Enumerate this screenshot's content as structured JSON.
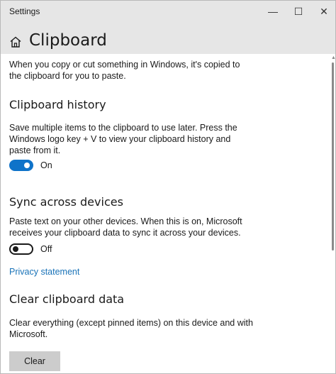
{
  "window": {
    "app_title": "Settings",
    "minimize_glyph": "—",
    "maximize_glyph": "☐",
    "close_glyph": "✕"
  },
  "page": {
    "title": "Clipboard",
    "intro": "When you copy or cut something in Windows, it's copied to the clipboard for you to paste."
  },
  "clipboard_history": {
    "heading": "Clipboard history",
    "description": "Save multiple items to the clipboard to use later. Press the Windows logo key + V to view your clipboard history and paste from it.",
    "toggle_state": "On"
  },
  "sync": {
    "heading": "Sync across devices",
    "description": "Paste text on your other devices. When this is on, Microsoft receives your clipboard data to sync it across your devices.",
    "toggle_state": "Off"
  },
  "privacy_link": "Privacy statement",
  "clear_data": {
    "heading": "Clear clipboard data",
    "description": "Clear everything (except pinned items) on this device and with Microsoft.",
    "button_label": "Clear"
  },
  "colors": {
    "accent": "#0f73c9",
    "link": "#1a73b8",
    "titlebar": "#e6e6e6",
    "button": "#cccccc"
  },
  "icons": {
    "home": "home-icon",
    "minimize": "minimize-icon",
    "maximize": "maximize-icon",
    "close": "close-icon"
  }
}
